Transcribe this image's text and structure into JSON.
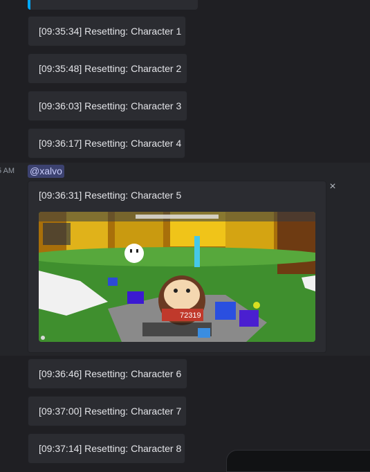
{
  "messages": [
    {
      "text": "[09:35:34] Resetting: Character 1"
    },
    {
      "text": "[09:35:48] Resetting: Character 2"
    },
    {
      "text": "[09:36:03] Resetting: Character 3"
    },
    {
      "text": "[09:36:17] Resetting: Character 4"
    }
  ],
  "highlighted": {
    "timestamp": "5 AM",
    "mention": "@xalvo",
    "text": "[09:36:31] Resetting: Character 5",
    "close_icon": "×",
    "screenshot": {
      "counter": "72319"
    }
  },
  "messages_after": [
    {
      "text": "[09:36:46] Resetting: Character 6"
    },
    {
      "text": "[09:37:00] Resetting: Character 7"
    },
    {
      "text": "[09:37:14] Resetting: Character 8"
    }
  ],
  "colors": {
    "background": "#1f1f23",
    "embed": "#2b2c31",
    "accent": "#00a8fc",
    "mention_bg": "#3c4270"
  }
}
